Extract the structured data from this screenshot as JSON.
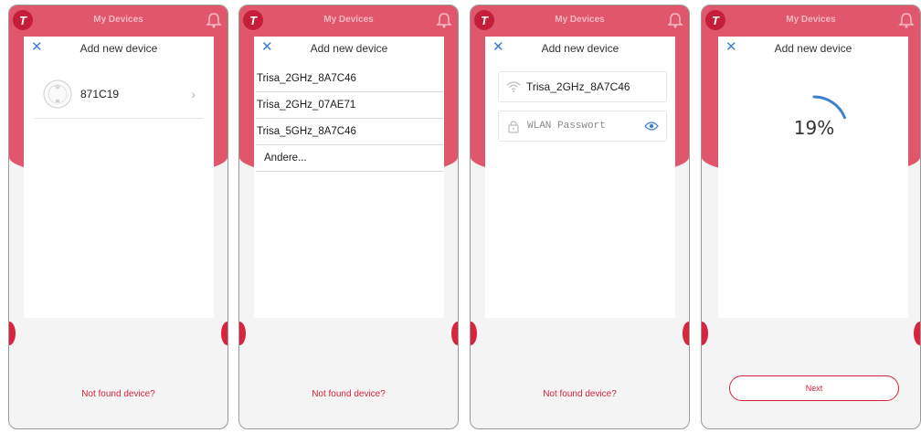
{
  "app": {
    "title": "My Devices",
    "logo_letter": "T"
  },
  "sheet": {
    "title": "Add new device",
    "close_label": "✕"
  },
  "screen1": {
    "device": {
      "name": "871C19",
      "icon": "robot-vacuum-icon"
    },
    "footer_link": "Not found device?"
  },
  "screen2": {
    "networks": [
      "Trisa_2GHz_8A7C46",
      "Trisa_2GHz_07AE71",
      "Trisa_5GHz_8A7C46"
    ],
    "other_label": "Andere...",
    "footer_link": "Not found device?"
  },
  "screen3": {
    "ssid": "Trisa_2GHz_8A7C46",
    "password_placeholder": "WLAN Passwort",
    "footer_link": "Not found device?"
  },
  "screen4": {
    "progress_label": "19%",
    "progress_value": 0.19,
    "next_label": "Next"
  },
  "colors": {
    "brand": "#d6233c",
    "header": "#e0566a",
    "accent": "#3d7fd0"
  }
}
